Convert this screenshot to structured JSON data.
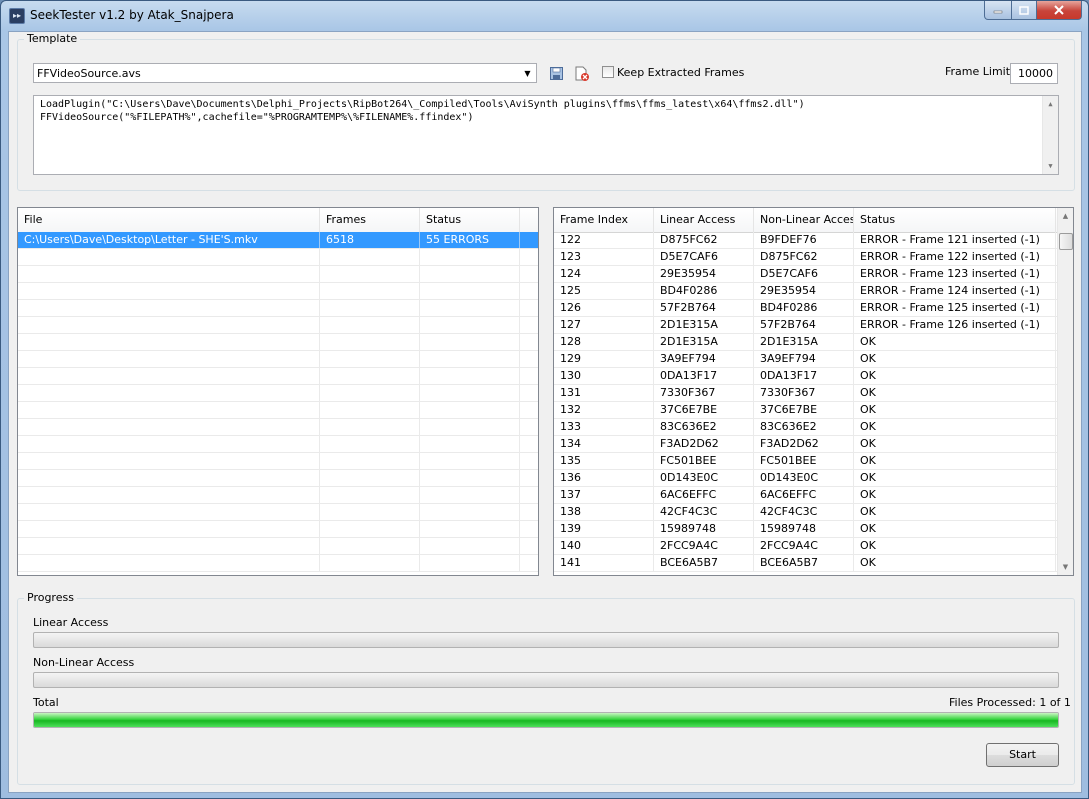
{
  "window": {
    "title": "SeekTester v1.2 by Atak_Snajpera",
    "app_icon_glyph": "▸▸"
  },
  "template": {
    "group_label": "Template",
    "selected_template": "FFVideoSource.avs",
    "keep_frames_label": "Keep Extracted Frames",
    "keep_frames_checked": false,
    "frame_limit_label": "Frame Limit:",
    "frame_limit_value": "10000",
    "script_lines": [
      "LoadPlugin(\"C:\\Users\\Dave\\Documents\\Delphi_Projects\\RipBot264\\_Compiled\\Tools\\AviSynth plugins\\ffms\\ffms_latest\\x64\\ffms2.dll\")",
      "FFVideoSource(\"%FILEPATH%\",cachefile=\"%PROGRAMTEMP%\\%FILENAME%.ffindex\")"
    ]
  },
  "files": {
    "columns": [
      "File",
      "Frames",
      "Status"
    ],
    "rows": [
      {
        "file": "C:\\Users\\Dave\\Desktop\\Letter - SHE'S.mkv",
        "frames": "6518",
        "status": "55 ERRORS"
      }
    ]
  },
  "frames": {
    "columns": [
      "Frame Index",
      "Linear Access",
      "Non-Linear Access",
      "Status"
    ],
    "rows": [
      [
        "122",
        "D875FC62",
        "B9FDEF76",
        "ERROR - Frame 121 inserted (-1)"
      ],
      [
        "123",
        "D5E7CAF6",
        "D875FC62",
        "ERROR - Frame 122 inserted (-1)"
      ],
      [
        "124",
        "29E35954",
        "D5E7CAF6",
        "ERROR - Frame 123 inserted (-1)"
      ],
      [
        "125",
        "BD4F0286",
        "29E35954",
        "ERROR - Frame 124 inserted (-1)"
      ],
      [
        "126",
        "57F2B764",
        "BD4F0286",
        "ERROR - Frame 125 inserted (-1)"
      ],
      [
        "127",
        "2D1E315A",
        "57F2B764",
        "ERROR - Frame 126 inserted (-1)"
      ],
      [
        "128",
        "2D1E315A",
        "2D1E315A",
        "OK"
      ],
      [
        "129",
        "3A9EF794",
        "3A9EF794",
        "OK"
      ],
      [
        "130",
        "0DA13F17",
        "0DA13F17",
        "OK"
      ],
      [
        "131",
        "7330F367",
        "7330F367",
        "OK"
      ],
      [
        "132",
        "37C6E7BE",
        "37C6E7BE",
        "OK"
      ],
      [
        "133",
        "83C636E2",
        "83C636E2",
        "OK"
      ],
      [
        "134",
        "F3AD2D62",
        "F3AD2D62",
        "OK"
      ],
      [
        "135",
        "FC501BEE",
        "FC501BEE",
        "OK"
      ],
      [
        "136",
        "0D143E0C",
        "0D143E0C",
        "OK"
      ],
      [
        "137",
        "6AC6EFFC",
        "6AC6EFFC",
        "OK"
      ],
      [
        "138",
        "42CF4C3C",
        "42CF4C3C",
        "OK"
      ],
      [
        "139",
        "15989748",
        "15989748",
        "OK"
      ],
      [
        "140",
        "2FCC9A4C",
        "2FCC9A4C",
        "OK"
      ],
      [
        "141",
        "BCE6A5B7",
        "BCE6A5B7",
        "OK"
      ]
    ]
  },
  "progress": {
    "group_label": "Progress",
    "linear_label": "Linear Access",
    "linear_fraction": 0,
    "nonlinear_label": "Non-Linear Access",
    "nonlinear_fraction": 0,
    "total_label": "Total",
    "total_fraction": 1,
    "files_processed_label": "Files Processed:",
    "files_processed_value": "1 of 1"
  },
  "buttons": {
    "start_label": "Start"
  },
  "colors": {
    "selection": "#3399ff",
    "progress_green": "#19b722",
    "close_red": "#c7392c"
  }
}
